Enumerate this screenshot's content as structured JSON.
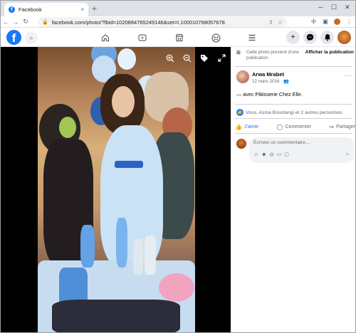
{
  "browser": {
    "tab_title": "Facebook",
    "tab_favicon": "f",
    "close_tab": "×",
    "new_tab": "+",
    "url": "facebook.com/photo/?fbid=1020884765249146&set=t.100010768057678",
    "window_controls": [
      "─",
      "☐",
      "✕"
    ]
  },
  "fb": {
    "logo": "f",
    "nav_icons": [
      "home-icon",
      "watch-icon",
      "marketplace-icon",
      "groups-icon",
      "menu-icon"
    ],
    "right_buttons": [
      "+",
      "messenger-icon",
      "notifications-icon",
      "profile-avatar"
    ]
  },
  "side_panel": {
    "notice_text": "Cette photo provient d’une publication.",
    "notice_link": "Afficher la publication",
    "author_name": "Arwa Mrabet",
    "post_date": "12 mars 2016 · ",
    "more": "···",
    "caption_prefix": "— avec ",
    "caption_page": "Pâtisserie Chez Elle",
    "caption_suffix": ".",
    "reactions_text": "Vous, Asma Boustangi et 2 autres personnes",
    "actions": {
      "like": "J’aime",
      "comment": "Commenter",
      "share": "Partager"
    },
    "comment_placeholder": "Écrivez un commentaire…"
  },
  "colors": {
    "brand": "#1877f2",
    "background": "#ffffff"
  }
}
